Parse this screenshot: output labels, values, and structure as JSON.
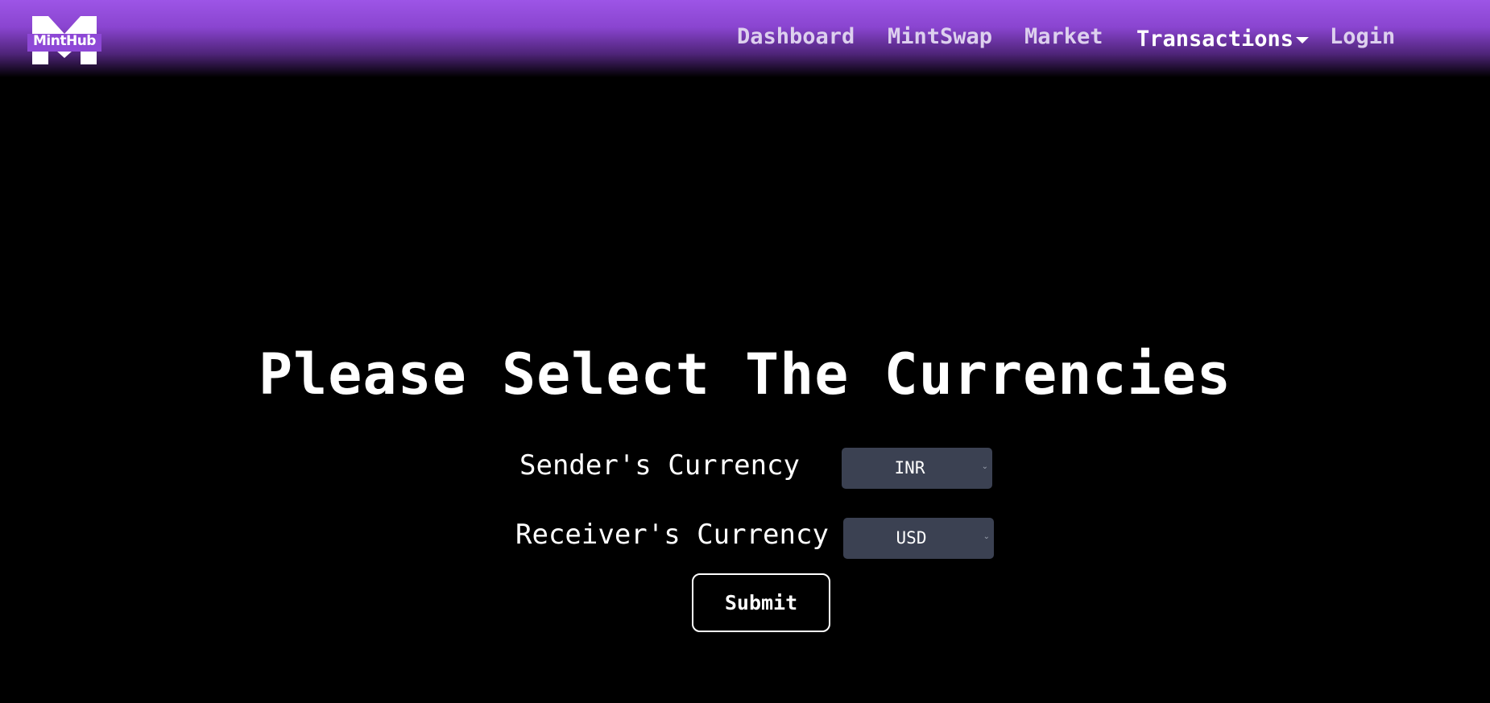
{
  "brand": {
    "name": "MintHub",
    "logo_icon": "minthub-m-logo"
  },
  "nav": {
    "links": [
      {
        "label": "Dashboard"
      },
      {
        "label": "MintSwap"
      },
      {
        "label": "Market"
      },
      {
        "label": "Transactions",
        "has_dropdown": true
      },
      {
        "label": "Login"
      }
    ]
  },
  "main": {
    "title": "Please Select The Currencies",
    "sender": {
      "label": "Sender's Currency",
      "selected": "INR"
    },
    "receiver": {
      "label": "Receiver's Currency",
      "selected": "USD"
    },
    "submit_label": "Submit"
  },
  "colors": {
    "navbar_top": "#9d55e6",
    "background": "#000000",
    "select_bg": "#3b4152",
    "nav_link": "#ddd0ee"
  }
}
